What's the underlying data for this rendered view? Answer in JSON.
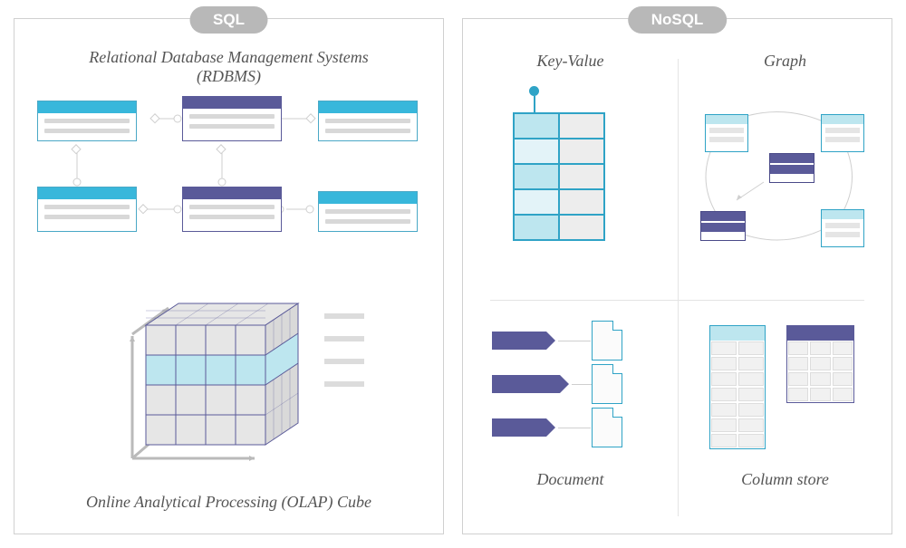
{
  "sql": {
    "chip": "SQL",
    "rdbms_title": "Relational Database Management Systems (RDBMS)",
    "olap_title": "Online Analytical Processing (OLAP) Cube"
  },
  "nosql": {
    "chip": "NoSQL",
    "kv_title": "Key-Value",
    "graph_title": "Graph",
    "doc_title": "Document",
    "col_title": "Column store"
  }
}
